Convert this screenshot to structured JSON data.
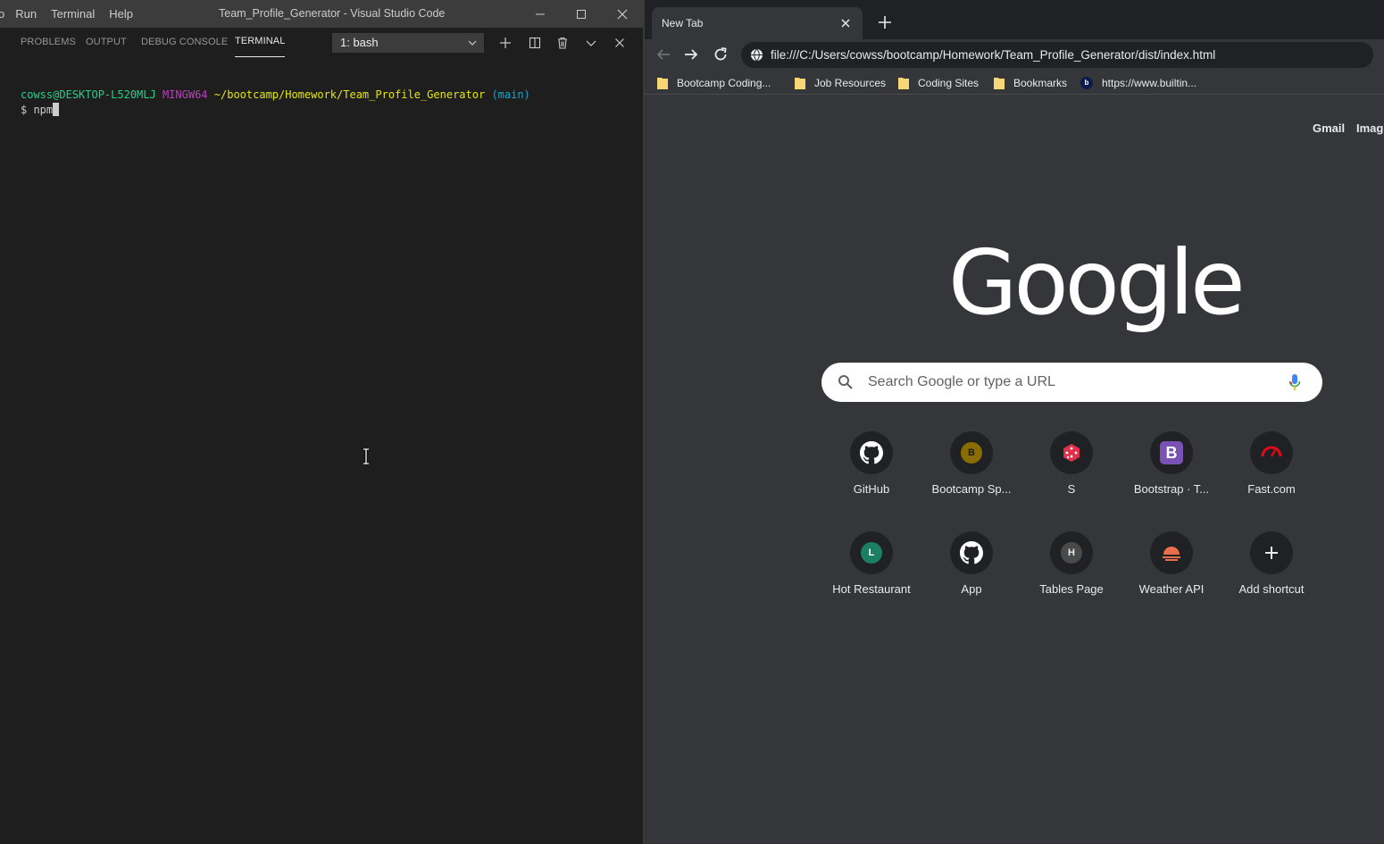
{
  "vscode": {
    "menu": [
      "o",
      "Run",
      "Terminal",
      "Help"
    ],
    "window_title": "Team_Profile_Generator - Visual Studio Code",
    "panel_tabs": [
      "PROBLEMS",
      "OUTPUT",
      "DEBUG CONSOLE",
      "TERMINAL"
    ],
    "active_panel_tab": "TERMINAL",
    "terminal_select": "1: bash",
    "terminal": {
      "user_host": "cowss@DESKTOP-L520MLJ",
      "env": "MINGW64",
      "path": "~/bootcamp/Homework/Team_Profile_Generator",
      "branch": "(main)",
      "prompt": "$ ",
      "command": "npm"
    }
  },
  "chrome": {
    "tab_title": "New Tab",
    "url": "file:///C:/Users/cowss/bootcamp/Homework/Team_Profile_Generator/dist/index.html",
    "bookmarks": [
      {
        "label": "Bootcamp Coding...",
        "icon": "folder-icon"
      },
      {
        "label": "Job Resources",
        "icon": "folder-icon"
      },
      {
        "label": "Coding Sites",
        "icon": "folder-icon"
      },
      {
        "label": "Bookmarks",
        "icon": "folder-icon"
      },
      {
        "label": "https://www.builtin...",
        "icon": "builtin-favicon",
        "letter": "b"
      }
    ],
    "top_links": [
      "Gmail",
      "Image"
    ],
    "logo_text": "Google",
    "search": {
      "placeholder": "Search Google or type a URL",
      "value": ""
    },
    "shortcuts": [
      {
        "label": "GitHub",
        "icon": "github-icon"
      },
      {
        "label": "Bootcamp Sp...",
        "icon": "letter-icon",
        "letter": "B",
        "color": "#8a6d00"
      },
      {
        "label": "S",
        "icon": "dice-icon",
        "color": "#e0314b"
      },
      {
        "label": "Bootstrap · T...",
        "icon": "bootstrap-icon",
        "letter": "B",
        "color": "#7952b3"
      },
      {
        "label": "Fast.com",
        "icon": "gauge-icon",
        "color": "#e50914"
      },
      {
        "label": "Hot Restaurant",
        "icon": "letter-icon",
        "letter": "L",
        "color": "#1a7f64"
      },
      {
        "label": "App",
        "icon": "github-icon"
      },
      {
        "label": "Tables Page",
        "icon": "letter-icon",
        "letter": "H",
        "color": "#4a4a4a"
      },
      {
        "label": "Weather API",
        "icon": "weather-icon",
        "color": "#eb6e4b"
      },
      {
        "label": "Add shortcut",
        "icon": "plus-icon"
      }
    ]
  },
  "colors": {
    "vscode_bg": "#1e1e1e",
    "vscode_titlebar": "#3c3c3c",
    "chrome_bg": "#35363a",
    "chrome_tabstrip": "#202124",
    "term_green": "#23d18b",
    "term_magenta": "#bc3fbc",
    "term_yellow": "#e5e510",
    "term_cyan": "#11a8cd"
  }
}
